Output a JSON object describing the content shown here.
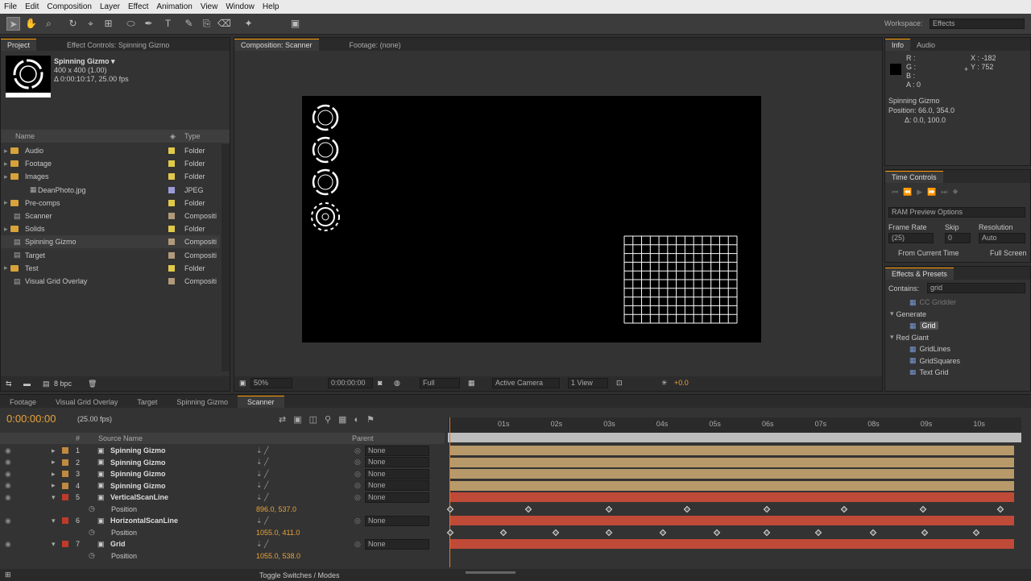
{
  "menu": [
    "File",
    "Edit",
    "Composition",
    "Layer",
    "Effect",
    "Animation",
    "View",
    "Window",
    "Help"
  ],
  "workspace": {
    "label": "Workspace:",
    "value": "Effects"
  },
  "project": {
    "tab_project": "Project",
    "tab_effect": "Effect Controls: Spinning Gizmo",
    "item_name": "Spinning Gizmo ▾",
    "item_size": "400 x 400 (1.00)",
    "item_duration": "Δ 0:00:10:17, 25.00 fps",
    "col_name": "Name",
    "col_type": "Type",
    "bpc": "8 bpc",
    "items": [
      {
        "name": "Audio",
        "type": "Folder",
        "kind": "folder",
        "color": "#e0c84a",
        "indent": 0
      },
      {
        "name": "Footage",
        "type": "Folder",
        "kind": "folder",
        "color": "#e0c84a",
        "indent": 0
      },
      {
        "name": "Images",
        "type": "Folder",
        "kind": "folder",
        "color": "#e0c84a",
        "indent": 0
      },
      {
        "name": "DeanPhoto.jpg",
        "type": "JPEG",
        "kind": "file",
        "color": "#9a9ad8",
        "indent": 1
      },
      {
        "name": "Pre-comps",
        "type": "Folder",
        "kind": "folder",
        "color": "#e0c84a",
        "indent": 0
      },
      {
        "name": "Scanner",
        "type": "Compositi",
        "kind": "comp",
        "color": "#b09a7a",
        "indent": 0
      },
      {
        "name": "Solids",
        "type": "Folder",
        "kind": "folder",
        "color": "#e0c84a",
        "indent": 0
      },
      {
        "name": "Spinning Gizmo",
        "type": "Compositi",
        "kind": "comp",
        "color": "#b09a7a",
        "indent": 0
      },
      {
        "name": "Target",
        "type": "Compositi",
        "kind": "comp",
        "color": "#b09a7a",
        "indent": 0
      },
      {
        "name": "Test",
        "type": "Folder",
        "kind": "folder",
        "color": "#e0c84a",
        "indent": 0
      },
      {
        "name": "Visual Grid Overlay",
        "type": "Compositi",
        "kind": "comp",
        "color": "#b09a7a",
        "indent": 0
      }
    ]
  },
  "comp": {
    "tab": "Composition: Scanner",
    "footage_tab": "Footage: (none)",
    "zoom": "50%",
    "timecode": "0:00:00:00",
    "resolution": "Full",
    "camera": "Active Camera",
    "view": "1 View",
    "exposure": "+0.0"
  },
  "info": {
    "tab_info": "Info",
    "tab_audio": "Audio",
    "r": "R :",
    "g": "G :",
    "b": "B :",
    "a": "A : 0",
    "x": "X : -182",
    "y": "Y : 752",
    "layer": "Spinning Gizmo",
    "position": "Position: 66.0, 354.0",
    "delta": "Δ: 0.0, 100.0"
  },
  "time_controls": {
    "title": "Time Controls",
    "ram": "RAM Preview Options",
    "frame_rate_label": "Frame Rate",
    "skip_label": "Skip",
    "resolution_label": "Resolution",
    "frame_rate": "(25)",
    "skip": "0",
    "resolution": "Auto",
    "from_current": "From Current Time",
    "full_screen": "Full Screen"
  },
  "effects": {
    "title": "Effects & Presets",
    "contains_label": "Contains:",
    "search": "grid",
    "items": [
      {
        "label": "CC Gridder",
        "type": "effect",
        "partial": true
      },
      {
        "label": "Generate",
        "type": "category"
      },
      {
        "label": "Grid",
        "type": "effect",
        "selected": true
      },
      {
        "label": "Red Giant",
        "type": "category"
      },
      {
        "label": "GridLines",
        "type": "effect"
      },
      {
        "label": "GridSquares",
        "type": "effect"
      },
      {
        "label": "Text Grid",
        "type": "effect"
      }
    ]
  },
  "timeline": {
    "tabs": [
      "Footage",
      "Visual Grid Overlay",
      "Target",
      "Spinning Gizmo",
      "Scanner"
    ],
    "active_tab": "Scanner",
    "timecode": "0:00:00:00",
    "fps": "(25.00 fps)",
    "col_num": "#",
    "col_source": "Source Name",
    "col_parent": "Parent",
    "toggle": "Toggle Switches / Modes",
    "ruler": [
      "01s",
      "02s",
      "03s",
      "04s",
      "05s",
      "06s",
      "07s",
      "08s",
      "09s",
      "10s"
    ],
    "layers": [
      {
        "num": "1",
        "name": "Spinning Gizmo",
        "parent": "None",
        "color": "#b89a6a",
        "label": "#c08a40",
        "expanded": false
      },
      {
        "num": "2",
        "name": "Spinning Gizmo",
        "parent": "None",
        "color": "#b89a6a",
        "label": "#c08a40",
        "expanded": false
      },
      {
        "num": "3",
        "name": "Spinning Gizmo",
        "parent": "None",
        "color": "#b89a6a",
        "label": "#c08a40",
        "expanded": false
      },
      {
        "num": "4",
        "name": "Spinning Gizmo",
        "parent": "None",
        "color": "#b89a6a",
        "label": "#c08a40",
        "expanded": false
      },
      {
        "num": "5",
        "name": "VerticalScanLine",
        "parent": "None",
        "color": "#c04a38",
        "label": "#c03a2a",
        "expanded": true,
        "prop": "Position",
        "value": "896.0, 537.0"
      },
      {
        "num": "6",
        "name": "HorizontalScanLine",
        "parent": "None",
        "color": "#c04a38",
        "label": "#c03a2a",
        "expanded": true,
        "prop": "Position",
        "value": "1055.0, 411.0"
      },
      {
        "num": "7",
        "name": "Grid",
        "parent": "None",
        "color": "#c04a38",
        "label": "#c03a2a",
        "expanded": true,
        "prop": "Position",
        "value": "1055.0, 538.0"
      }
    ],
    "keys_v": [
      0,
      0.14,
      0.285,
      0.425,
      0.568,
      0.706,
      0.848,
      0.987
    ],
    "keys_h": [
      0,
      0.095,
      0.19,
      0.285,
      0.382,
      0.478,
      0.568,
      0.66,
      0.758,
      0.851,
      0.944
    ]
  }
}
